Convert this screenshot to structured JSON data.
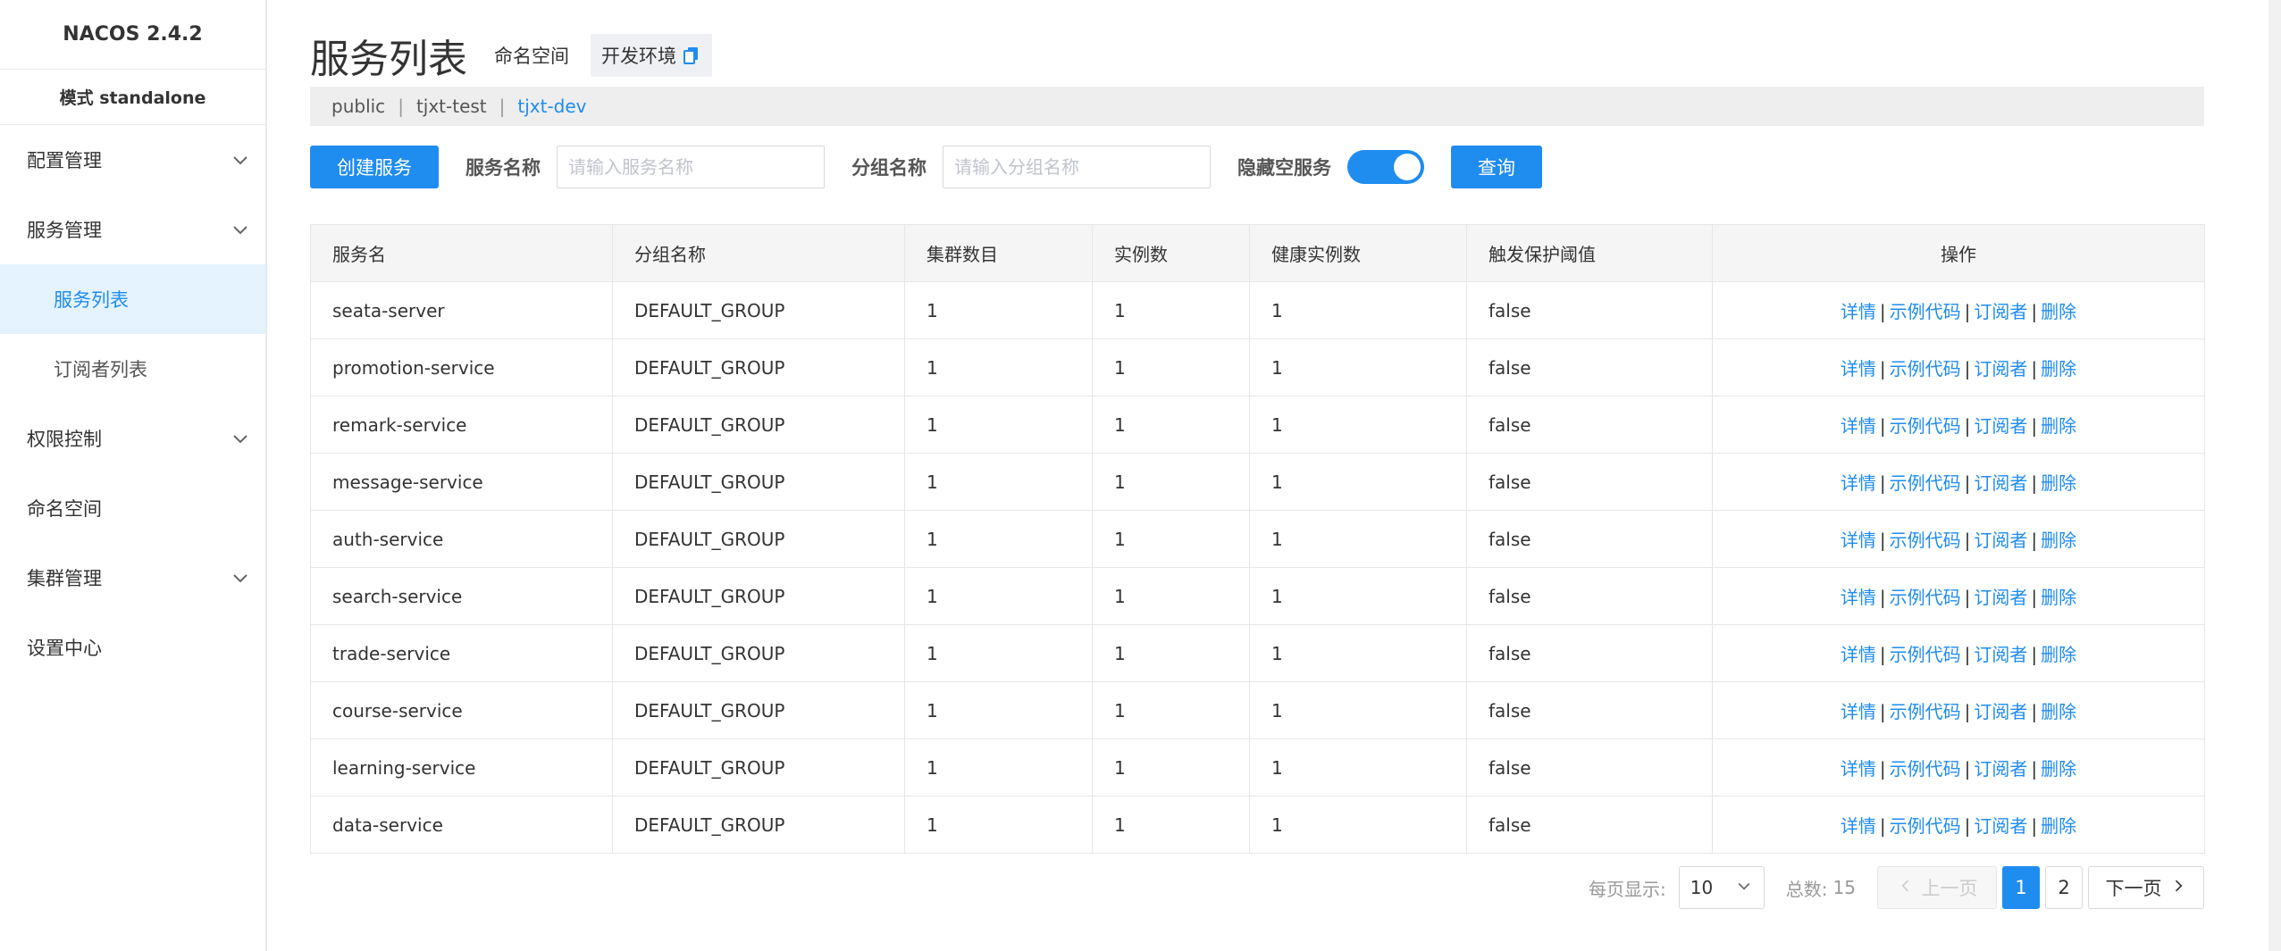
{
  "sidebar": {
    "logo": "NACOS 2.4.2",
    "mode": "模式 standalone",
    "items": [
      {
        "label": "配置管理"
      },
      {
        "label": "服务管理"
      },
      {
        "label": "服务列表"
      },
      {
        "label": "订阅者列表"
      },
      {
        "label": "权限控制"
      },
      {
        "label": "命名空间"
      },
      {
        "label": "集群管理"
      },
      {
        "label": "设置中心"
      }
    ]
  },
  "header": {
    "title": "服务列表",
    "namespace_label": "命名空间",
    "namespace_current": "开发环境",
    "namespaces": [
      "public",
      "tjxt-test",
      "tjxt-dev"
    ],
    "separator": "|"
  },
  "filters": {
    "create_button": "创建服务",
    "service_name_label": "服务名称",
    "service_name_placeholder": "请输入服务名称",
    "group_name_label": "分组名称",
    "group_name_placeholder": "请输入分组名称",
    "hide_empty_label": "隐藏空服务",
    "hide_empty_on": true,
    "query_button": "查询"
  },
  "table": {
    "columns": [
      "服务名",
      "分组名称",
      "集群数目",
      "实例数",
      "健康实例数",
      "触发保护阈值",
      "操作"
    ],
    "ops": [
      "详情",
      "示例代码",
      "订阅者",
      "删除"
    ],
    "ops_separator": "|",
    "rows": [
      [
        "seata-server",
        "DEFAULT_GROUP",
        "1",
        "1",
        "1",
        "false"
      ],
      [
        "promotion-service",
        "DEFAULT_GROUP",
        "1",
        "1",
        "1",
        "false"
      ],
      [
        "remark-service",
        "DEFAULT_GROUP",
        "1",
        "1",
        "1",
        "false"
      ],
      [
        "message-service",
        "DEFAULT_GROUP",
        "1",
        "1",
        "1",
        "false"
      ],
      [
        "auth-service",
        "DEFAULT_GROUP",
        "1",
        "1",
        "1",
        "false"
      ],
      [
        "search-service",
        "DEFAULT_GROUP",
        "1",
        "1",
        "1",
        "false"
      ],
      [
        "trade-service",
        "DEFAULT_GROUP",
        "1",
        "1",
        "1",
        "false"
      ],
      [
        "course-service",
        "DEFAULT_GROUP",
        "1",
        "1",
        "1",
        "false"
      ],
      [
        "learning-service",
        "DEFAULT_GROUP",
        "1",
        "1",
        "1",
        "false"
      ],
      [
        "data-service",
        "DEFAULT_GROUP",
        "1",
        "1",
        "1",
        "false"
      ]
    ]
  },
  "pagination": {
    "per_page_label": "每页显示:",
    "per_page_value": "10",
    "total_label": "总数:",
    "total": "15",
    "prev": "上一页",
    "next": "下一页",
    "pages": [
      "1",
      "2"
    ]
  },
  "colors": {
    "accent": "#1f8cf0",
    "active_menu_bg": "#e5f3ff"
  }
}
